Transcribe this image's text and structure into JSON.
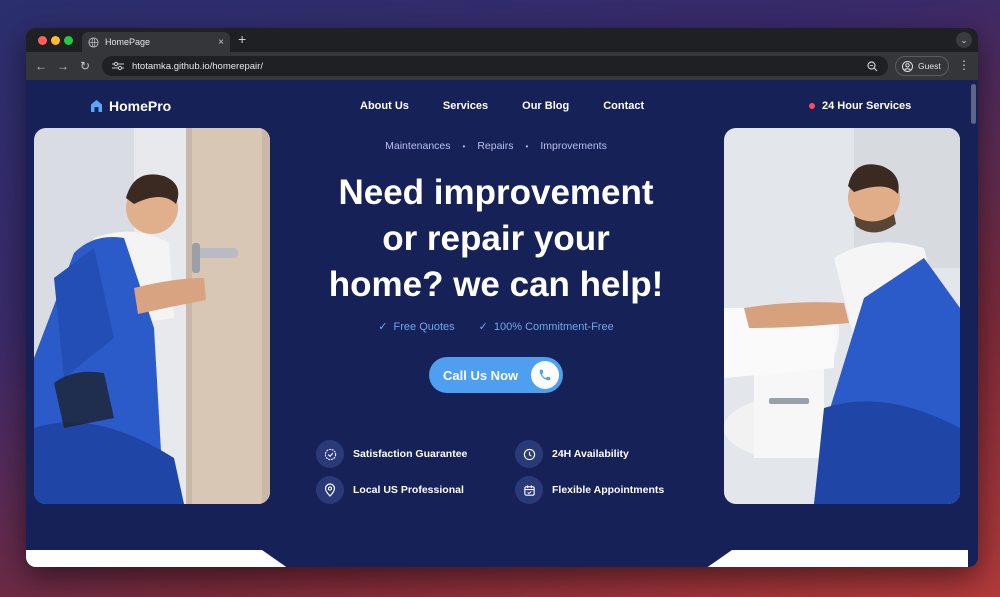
{
  "browser": {
    "tab_title": "HomePage",
    "tab_close": "×",
    "new_tab": "+",
    "url": "htotamka.github.io/homerepair/",
    "profile_label": "Guest",
    "nav_back": "←",
    "nav_forward": "→",
    "nav_reload": "↻",
    "menu": "⋮",
    "tab_menu": "⌄"
  },
  "site": {
    "brand": "HomePro",
    "nav": [
      "About Us",
      "Services",
      "Our Blog",
      "Contact"
    ],
    "hours": "24 Hour Services",
    "crumbs": [
      "Maintenances",
      "Repairs",
      "Improvements"
    ],
    "crumb_separator": "•",
    "headline": [
      "Need improvement",
      "or repair your",
      "home? we can help!"
    ],
    "checks": [
      "Free Quotes",
      "100% Commitment-Free"
    ],
    "check_glyph": "✓",
    "cta": "Call Us Now",
    "features": [
      {
        "label": "Satisfaction Guarantee",
        "icon": "badge-check-icon"
      },
      {
        "label": "24H Availability",
        "icon": "clock-icon"
      },
      {
        "label": "Local US Professional",
        "icon": "map-pin-icon"
      },
      {
        "label": "Flexible Appointments",
        "icon": "calendar-icon"
      }
    ]
  },
  "colors": {
    "page_bg": "#162157",
    "accent": "#4f9ff0",
    "hours_dot": "#ff4b5c",
    "check_text": "#6fa7f0"
  }
}
